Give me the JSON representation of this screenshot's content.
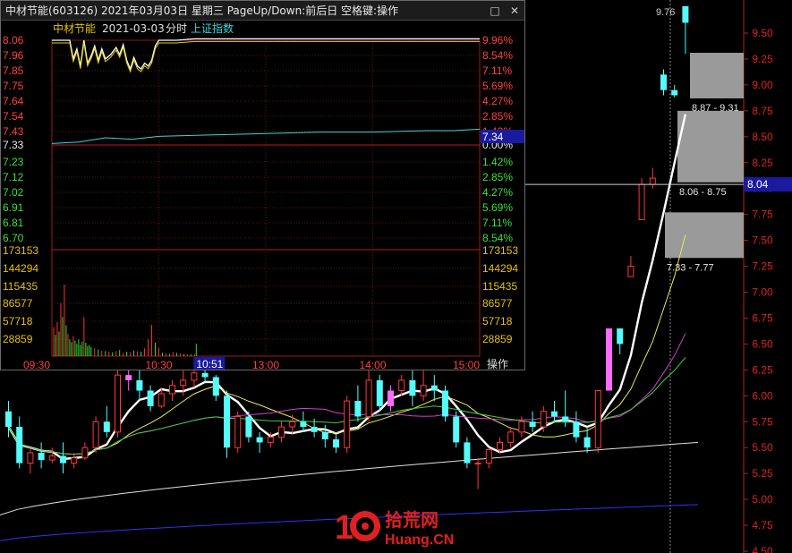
{
  "window": {
    "title": "中材节能(603126) 2021年03月03日 星期三 PageUp/Down:前后日 空格键:操作",
    "minimize_label": "□",
    "close_label": "✕",
    "op_label": "操作"
  },
  "intraday": {
    "stock_name": "中材节能",
    "date": "2021-03-03",
    "mode": "分时",
    "index_name": "上证指数",
    "prev_close": 7.33,
    "current_price_label": "7.34",
    "cursor_time_label": "10:51",
    "price_ticks": [
      "8.06",
      "7.96",
      "7.85",
      "7.75",
      "7.64",
      "7.54",
      "7.43",
      "7.33",
      "7.23",
      "7.12",
      "7.02",
      "6.91",
      "6.81",
      "6.70"
    ],
    "pct_ticks": [
      "9.96%",
      "8.54%",
      "7.11%",
      "5.69%",
      "4.27%",
      "2.85%",
      "1.42%",
      "0.00%",
      "1.42%",
      "2.85%",
      "4.27%",
      "5.69%",
      "7.11%",
      "8.54%"
    ],
    "volume_ticks": [
      "173153",
      "144294",
      "115435",
      "86577",
      "57718",
      "28859"
    ],
    "time_ticks": [
      "09:30",
      "10:30",
      "13:00",
      "14:00",
      "15:00"
    ],
    "price_line": [
      {
        "m": 0,
        "v": 8.06
      },
      {
        "m": 10,
        "v": 8.06
      },
      {
        "m": 12,
        "v": 7.93
      },
      {
        "m": 14,
        "v": 8.0
      },
      {
        "m": 16,
        "v": 7.88
      },
      {
        "m": 18,
        "v": 8.06
      },
      {
        "m": 20,
        "v": 7.9
      },
      {
        "m": 22,
        "v": 7.95
      },
      {
        "m": 24,
        "v": 8.02
      },
      {
        "m": 26,
        "v": 7.92
      },
      {
        "m": 28,
        "v": 8.0
      },
      {
        "m": 30,
        "v": 7.93
      },
      {
        "m": 33,
        "v": 7.96
      },
      {
        "m": 36,
        "v": 8.01
      },
      {
        "m": 38,
        "v": 7.96
      },
      {
        "m": 40,
        "v": 8.03
      },
      {
        "m": 42,
        "v": 7.92
      },
      {
        "m": 44,
        "v": 7.86
      },
      {
        "m": 46,
        "v": 7.94
      },
      {
        "m": 48,
        "v": 7.88
      },
      {
        "m": 50,
        "v": 7.86
      },
      {
        "m": 52,
        "v": 7.9
      },
      {
        "m": 54,
        "v": 7.88
      },
      {
        "m": 56,
        "v": 7.92
      },
      {
        "m": 58,
        "v": 8.02
      },
      {
        "m": 60,
        "v": 8.06
      },
      {
        "m": 70,
        "v": 8.06
      },
      {
        "m": 80,
        "v": 8.07
      },
      {
        "m": 240,
        "v": 8.07
      }
    ],
    "index_line": [
      {
        "m": 0,
        "v": 7.34
      },
      {
        "m": 15,
        "v": 7.35
      },
      {
        "m": 30,
        "v": 7.38
      },
      {
        "m": 45,
        "v": 7.37
      },
      {
        "m": 60,
        "v": 7.39
      },
      {
        "m": 90,
        "v": 7.4
      },
      {
        "m": 120,
        "v": 7.41
      },
      {
        "m": 150,
        "v": 7.42
      },
      {
        "m": 180,
        "v": 7.42
      },
      {
        "m": 210,
        "v": 7.43
      },
      {
        "m": 225,
        "v": 7.43
      },
      {
        "m": 240,
        "v": 7.44
      }
    ],
    "volume_bars": [
      {
        "m": 1,
        "v": 52000,
        "c": "red"
      },
      {
        "m": 2,
        "v": 38000,
        "c": "green"
      },
      {
        "m": 3,
        "v": 61000,
        "c": "red"
      },
      {
        "m": 4,
        "v": 44000,
        "c": "green"
      },
      {
        "m": 5,
        "v": 95000,
        "c": "red"
      },
      {
        "m": 6,
        "v": 70000,
        "c": "green"
      },
      {
        "m": 7,
        "v": 128000,
        "c": "red"
      },
      {
        "m": 8,
        "v": 55000,
        "c": "green"
      },
      {
        "m": 9,
        "v": 40000,
        "c": "red"
      },
      {
        "m": 10,
        "v": 30000,
        "c": "green"
      },
      {
        "m": 11,
        "v": 25000,
        "c": "green"
      },
      {
        "m": 12,
        "v": 36000,
        "c": "red"
      },
      {
        "m": 13,
        "v": 28000,
        "c": "green"
      },
      {
        "m": 14,
        "v": 22000,
        "c": "green"
      },
      {
        "m": 15,
        "v": 30000,
        "c": "green"
      },
      {
        "m": 16,
        "v": 20000,
        "c": "green"
      },
      {
        "m": 17,
        "v": 26000,
        "c": "green"
      },
      {
        "m": 18,
        "v": 70000,
        "c": "red"
      },
      {
        "m": 19,
        "v": 24000,
        "c": "green"
      },
      {
        "m": 20,
        "v": 18000,
        "c": "green"
      },
      {
        "m": 21,
        "v": 20000,
        "c": "green"
      },
      {
        "m": 22,
        "v": 16000,
        "c": "green"
      },
      {
        "m": 24,
        "v": 14000,
        "c": "red"
      },
      {
        "m": 26,
        "v": 12000,
        "c": "green"
      },
      {
        "m": 28,
        "v": 10000,
        "c": "red"
      },
      {
        "m": 30,
        "v": 9000,
        "c": "green"
      },
      {
        "m": 32,
        "v": 8000,
        "c": "red"
      },
      {
        "m": 34,
        "v": 7000,
        "c": "green"
      },
      {
        "m": 36,
        "v": 9000,
        "c": "red"
      },
      {
        "m": 38,
        "v": 11000,
        "c": "green"
      },
      {
        "m": 40,
        "v": 6000,
        "c": "red"
      },
      {
        "m": 42,
        "v": 8000,
        "c": "green"
      },
      {
        "m": 44,
        "v": 7000,
        "c": "red"
      },
      {
        "m": 46,
        "v": 10000,
        "c": "green"
      },
      {
        "m": 48,
        "v": 9000,
        "c": "red"
      },
      {
        "m": 50,
        "v": 8000,
        "c": "green"
      },
      {
        "m": 52,
        "v": 14000,
        "c": "red"
      },
      {
        "m": 54,
        "v": 30000,
        "c": "red"
      },
      {
        "m": 56,
        "v": 56000,
        "c": "red"
      },
      {
        "m": 58,
        "v": 24000,
        "c": "green"
      },
      {
        "m": 60,
        "v": 15000,
        "c": "red"
      },
      {
        "m": 62,
        "v": 6000,
        "c": "green"
      },
      {
        "m": 64,
        "v": 5000,
        "c": "red"
      },
      {
        "m": 66,
        "v": 4000,
        "c": "green"
      },
      {
        "m": 68,
        "v": 7000,
        "c": "red"
      },
      {
        "m": 70,
        "v": 6000,
        "c": "green"
      },
      {
        "m": 72,
        "v": 5000,
        "c": "red"
      },
      {
        "m": 74,
        "v": 4000,
        "c": "green"
      },
      {
        "m": 76,
        "v": 3000,
        "c": "red"
      },
      {
        "m": 78,
        "v": 3000,
        "c": "green"
      },
      {
        "m": 80,
        "v": 4000,
        "c": "red"
      },
      {
        "m": 81,
        "v": 22000,
        "c": "green"
      }
    ]
  },
  "daily": {
    "price_ticks": [
      "9.50",
      "9.25",
      "9.00",
      "8.75",
      "8.50",
      "8.25",
      "8.00",
      "7.75",
      "7.50",
      "7.25",
      "7.00",
      "6.75",
      "6.50",
      "6.25",
      "6.00",
      "5.75",
      "5.50",
      "5.25",
      "5.00",
      "4.75",
      "4.50"
    ],
    "current_price_label": "8.04",
    "current_price": 8.04,
    "high_label": "9.76",
    "zones": [
      {
        "label": "8.87 - 9.31",
        "low": 8.87,
        "high": 9.31
      },
      {
        "label": "8.06 - 8.75",
        "low": 8.06,
        "high": 8.75
      },
      {
        "label": "7.33 - 7.77",
        "low": 7.33,
        "high": 7.77
      }
    ],
    "candles": [
      {
        "o": 5.85,
        "h": 5.95,
        "l": 5.6,
        "c": 5.7
      },
      {
        "o": 5.7,
        "h": 5.8,
        "l": 5.3,
        "c": 5.35
      },
      {
        "o": 5.35,
        "h": 5.5,
        "l": 5.25,
        "c": 5.45
      },
      {
        "o": 5.45,
        "h": 5.55,
        "l": 5.3,
        "c": 5.38
      },
      {
        "o": 5.38,
        "h": 5.5,
        "l": 5.35,
        "c": 5.42
      },
      {
        "o": 5.42,
        "h": 5.55,
        "l": 5.25,
        "c": 5.35
      },
      {
        "o": 5.35,
        "h": 5.45,
        "l": 5.3,
        "c": 5.4
      },
      {
        "o": 5.4,
        "h": 5.55,
        "l": 5.38,
        "c": 5.5
      },
      {
        "o": 5.5,
        "h": 5.8,
        "l": 5.45,
        "c": 5.75
      },
      {
        "o": 5.75,
        "h": 5.9,
        "l": 5.6,
        "c": 5.65
      },
      {
        "o": 5.65,
        "h": 6.3,
        "l": 5.6,
        "c": 6.2
      },
      {
        "o": 6.2,
        "h": 6.3,
        "l": 6.05,
        "c": 6.15
      },
      {
        "o": 6.15,
        "h": 6.25,
        "l": 5.95,
        "c": 6.05
      },
      {
        "o": 6.05,
        "h": 6.1,
        "l": 5.85,
        "c": 5.9
      },
      {
        "o": 5.9,
        "h": 6.08,
        "l": 5.88,
        "c": 6.02
      },
      {
        "o": 6.02,
        "h": 6.15,
        "l": 5.95,
        "c": 6.1
      },
      {
        "o": 6.1,
        "h": 6.25,
        "l": 6.0,
        "c": 6.15
      },
      {
        "o": 6.15,
        "h": 6.3,
        "l": 6.08,
        "c": 6.22
      },
      {
        "o": 6.22,
        "h": 6.3,
        "l": 6.12,
        "c": 6.18
      },
      {
        "o": 6.18,
        "h": 6.2,
        "l": 5.95,
        "c": 6.0
      },
      {
        "o": 6.0,
        "h": 6.05,
        "l": 5.4,
        "c": 5.5
      },
      {
        "o": 5.5,
        "h": 5.85,
        "l": 5.45,
        "c": 5.8
      },
      {
        "o": 5.8,
        "h": 5.85,
        "l": 5.55,
        "c": 5.6
      },
      {
        "o": 5.6,
        "h": 5.65,
        "l": 5.45,
        "c": 5.55
      },
      {
        "o": 5.55,
        "h": 5.65,
        "l": 5.5,
        "c": 5.6
      },
      {
        "o": 5.6,
        "h": 5.75,
        "l": 5.55,
        "c": 5.7
      },
      {
        "o": 5.7,
        "h": 5.82,
        "l": 5.62,
        "c": 5.75
      },
      {
        "o": 5.75,
        "h": 5.85,
        "l": 5.65,
        "c": 5.7
      },
      {
        "o": 5.7,
        "h": 5.78,
        "l": 5.6,
        "c": 5.65
      },
      {
        "o": 5.65,
        "h": 5.72,
        "l": 5.5,
        "c": 5.58
      },
      {
        "o": 5.58,
        "h": 5.62,
        "l": 5.45,
        "c": 5.5
      },
      {
        "o": 5.5,
        "h": 6.0,
        "l": 5.45,
        "c": 5.95
      },
      {
        "o": 5.95,
        "h": 6.1,
        "l": 5.75,
        "c": 5.8
      },
      {
        "o": 5.8,
        "h": 6.25,
        "l": 5.75,
        "c": 6.15
      },
      {
        "o": 6.15,
        "h": 6.2,
        "l": 5.85,
        "c": 5.9
      },
      {
        "o": 5.9,
        "h": 6.1,
        "l": 5.85,
        "c": 6.05
      },
      {
        "o": 6.05,
        "h": 6.2,
        "l": 6.0,
        "c": 6.15
      },
      {
        "o": 6.15,
        "h": 6.25,
        "l": 5.9,
        "c": 6.0
      },
      {
        "o": 6.0,
        "h": 6.25,
        "l": 5.95,
        "c": 6.1
      },
      {
        "o": 6.1,
        "h": 6.2,
        "l": 5.95,
        "c": 6.05
      },
      {
        "o": 6.05,
        "h": 6.1,
        "l": 5.75,
        "c": 5.8
      },
      {
        "o": 5.8,
        "h": 5.85,
        "l": 5.5,
        "c": 5.55
      },
      {
        "o": 5.55,
        "h": 5.6,
        "l": 5.3,
        "c": 5.35
      },
      {
        "o": 5.35,
        "h": 5.4,
        "l": 5.1,
        "c": 5.35
      },
      {
        "o": 5.35,
        "h": 5.5,
        "l": 5.3,
        "c": 5.48
      },
      {
        "o": 5.48,
        "h": 5.6,
        "l": 5.45,
        "c": 5.55
      },
      {
        "o": 5.55,
        "h": 5.7,
        "l": 5.5,
        "c": 5.65
      },
      {
        "o": 5.65,
        "h": 5.8,
        "l": 5.6,
        "c": 5.75
      },
      {
        "o": 5.75,
        "h": 5.85,
        "l": 5.65,
        "c": 5.7
      },
      {
        "o": 5.7,
        "h": 5.9,
        "l": 5.65,
        "c": 5.85
      },
      {
        "o": 5.85,
        "h": 5.95,
        "l": 5.75,
        "c": 5.8
      },
      {
        "o": 5.8,
        "h": 6.05,
        "l": 5.7,
        "c": 5.75
      },
      {
        "o": 5.75,
        "h": 5.85,
        "l": 5.55,
        "c": 5.6
      },
      {
        "o": 5.6,
        "h": 5.7,
        "l": 5.45,
        "c": 5.5
      },
      {
        "o": 5.5,
        "h": 6.05,
        "l": 5.45,
        "c": 6.05
      },
      {
        "o": 6.05,
        "h": 6.65,
        "l": 6.05,
        "c": 6.65
      },
      {
        "o": 6.65,
        "h": 6.65,
        "l": 6.4,
        "c": 6.5
      },
      {
        "o": 7.15,
        "h": 7.35,
        "l": 7.15,
        "c": 7.25
      },
      {
        "o": 7.7,
        "h": 8.1,
        "l": 7.7,
        "c": 8.04
      },
      {
        "o": 8.04,
        "h": 8.2,
        "l": 8.0,
        "c": 8.1
      },
      {
        "o": 9.1,
        "h": 9.15,
        "l": 8.9,
        "c": 8.95
      },
      {
        "o": 8.95,
        "h": 9.0,
        "l": 8.88,
        "c": 8.9
      },
      {
        "o": 9.76,
        "h": 9.76,
        "l": 9.3,
        "c": 9.6
      }
    ]
  }
}
